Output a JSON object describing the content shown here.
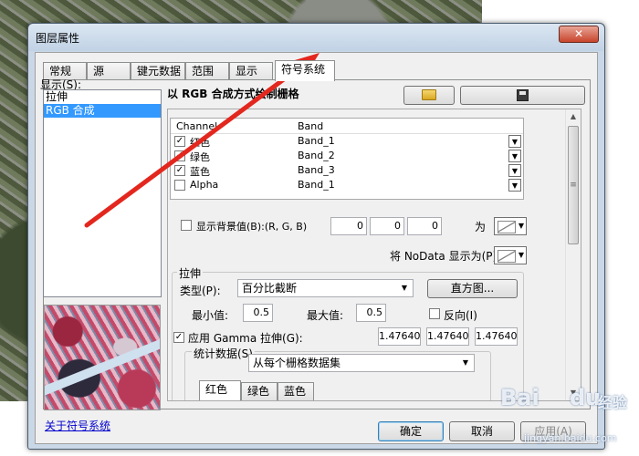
{
  "window": {
    "title": "图层属性",
    "close_glyph": "✕"
  },
  "tabs": [
    "常规",
    "源",
    "键元数据",
    "范围",
    "显示",
    "符号系统"
  ],
  "active_tab": "符号系统",
  "left_panel": {
    "show_label": "显示(S):",
    "items": [
      "拉伸",
      "RGB 合成"
    ],
    "selected": "RGB 合成",
    "about_link": "关于符号系统"
  },
  "main": {
    "heading": "以 RGB 合成方式绘制栅格",
    "channel_table": {
      "headers": [
        "Channel",
        "Band"
      ],
      "rows": [
        {
          "channel": "红色",
          "band": "Band_1",
          "checked": true
        },
        {
          "channel": "绿色",
          "band": "Band_2",
          "checked": true
        },
        {
          "channel": "蓝色",
          "band": "Band_3",
          "checked": true
        },
        {
          "channel": "Alpha",
          "band": "Band_1",
          "checked": false
        }
      ]
    },
    "background": {
      "label": "显示背景值(B):(R, G, B)",
      "values": [
        "0",
        "0",
        "0"
      ],
      "as_label": "为"
    },
    "nodata_label": "将 NoData 显示为(P)",
    "stretch": {
      "group_label": "拉伸",
      "type_label": "类型(P):",
      "type_value": "百分比截断",
      "histogram_button": "直方图...",
      "min_label": "最小值:",
      "min_value": "0.5",
      "max_label": "最大值:",
      "max_value": "0.5",
      "invert_label": "反向(I)",
      "gamma_label": "应用 Gamma 拉伸(G):",
      "gamma_values": [
        "1.47640",
        "1.47640",
        "1.47640"
      ],
      "stats_label": "统计数据(S)",
      "stats_value": "从每个栅格数据集",
      "sub_tabs": [
        "红色",
        "绿色",
        "蓝色"
      ]
    }
  },
  "buttons": {
    "ok": "确定",
    "cancel": "取消",
    "apply": "应用(A)"
  },
  "watermark": {
    "text1": "Bai",
    "text2": "du",
    "text3": "经验",
    "url": "jingyan.baidu.com"
  },
  "colors": {
    "selection": "#3399ff",
    "annotation_arrow": "#e3271e"
  }
}
